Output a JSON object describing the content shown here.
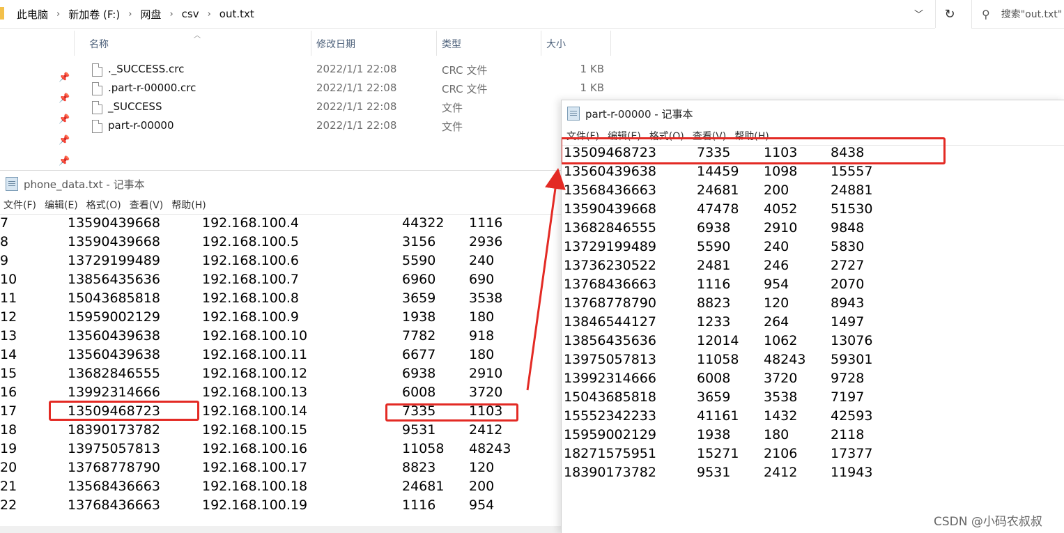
{
  "explorer": {
    "breadcrumbs": [
      "此电脑",
      "新加卷 (F:)",
      "网盘",
      "csv",
      "out.txt"
    ],
    "search_placeholder": "搜索\"out.txt\"",
    "columns": {
      "name": "名称",
      "date": "修改日期",
      "type": "类型",
      "size": "大小"
    },
    "files": [
      {
        "name": "._SUCCESS.crc",
        "date": "2022/1/1 22:08",
        "type": "CRC 文件",
        "size": "1 KB"
      },
      {
        "name": ".part-r-00000.crc",
        "date": "2022/1/1 22:08",
        "type": "CRC 文件",
        "size": "1 KB"
      },
      {
        "name": "_SUCCESS",
        "date": "2022/1/1 22:08",
        "type": "文件",
        "size": ""
      },
      {
        "name": "part-r-00000",
        "date": "2022/1/1 22:08",
        "type": "文件",
        "size": ""
      }
    ]
  },
  "notepad_left": {
    "title": "phone_data.txt - 记事本",
    "menu": [
      "文件(F)",
      "编辑(E)",
      "格式(O)",
      "查看(V)",
      "帮助(H)"
    ],
    "rows": [
      [
        "7",
        "13590439668",
        "192.168.100.4",
        "44322",
        "1116"
      ],
      [
        "8",
        "13590439668",
        "192.168.100.5",
        "3156",
        "2936"
      ],
      [
        "9",
        "13729199489",
        "192.168.100.6",
        "5590",
        "240"
      ],
      [
        "10",
        "13856435636",
        "192.168.100.7",
        "6960",
        "690"
      ],
      [
        "11",
        "15043685818",
        "192.168.100.8",
        "3659",
        "3538"
      ],
      [
        "12",
        "15959002129",
        "192.168.100.9",
        "1938",
        "180"
      ],
      [
        "13",
        "13560439638",
        "192.168.100.10",
        "7782",
        "918"
      ],
      [
        "14",
        "13560439638",
        "192.168.100.11",
        "6677",
        "180"
      ],
      [
        "15",
        "13682846555",
        "192.168.100.12",
        "6938",
        "2910"
      ],
      [
        "16",
        "13992314666",
        "192.168.100.13",
        "6008",
        "3720"
      ],
      [
        "17",
        "13509468723",
        "192.168.100.14",
        "7335",
        "1103"
      ],
      [
        "18",
        "18390173782",
        "192.168.100.15",
        "9531",
        "2412"
      ],
      [
        "19",
        "13975057813",
        "192.168.100.16",
        "11058",
        "48243"
      ],
      [
        "20",
        "13768778790",
        "192.168.100.17",
        "8823",
        "120"
      ],
      [
        "21",
        "13568436663",
        "192.168.100.18",
        "24681",
        "200"
      ],
      [
        "22",
        "13768436663",
        "192.168.100.19",
        "1116",
        "954"
      ]
    ]
  },
  "notepad_right": {
    "title": "part-r-00000 - 记事本",
    "menu": [
      "文件(F)",
      "编辑(E)",
      "格式(O)",
      "查看(V)",
      "帮助(H)"
    ],
    "rows": [
      [
        "13509468723",
        "7335",
        "1103",
        "8438"
      ],
      [
        "13560439638",
        "14459",
        "1098",
        "15557"
      ],
      [
        "13568436663",
        "24681",
        "200",
        "24881"
      ],
      [
        "13590439668",
        "47478",
        "4052",
        "51530"
      ],
      [
        "13682846555",
        "6938",
        "2910",
        "9848"
      ],
      [
        "13729199489",
        "5590",
        "240",
        "5830"
      ],
      [
        "13736230522",
        "2481",
        "246",
        "2727"
      ],
      [
        "13768436663",
        "1116",
        "954",
        "2070"
      ],
      [
        "13768778790",
        "8823",
        "120",
        "8943"
      ],
      [
        "13846544127",
        "1233",
        "264",
        "1497"
      ],
      [
        "13856435636",
        "12014",
        "1062",
        "13076"
      ],
      [
        "13975057813",
        "11058",
        "48243",
        "59301"
      ],
      [
        "13992314666",
        "6008",
        "3720",
        "9728"
      ],
      [
        "15043685818",
        "3659",
        "3538",
        "7197"
      ],
      [
        "15552342233",
        "41161",
        "1432",
        "42593"
      ],
      [
        "15959002129",
        "1938",
        "180",
        "2118"
      ],
      [
        "18271575951",
        "15271",
        "2106",
        "17377"
      ],
      [
        "18390173782",
        "9531",
        "2412",
        "11943"
      ]
    ]
  },
  "annotation_color": "#e32a24",
  "watermark": "CSDN @小码农叔叔"
}
